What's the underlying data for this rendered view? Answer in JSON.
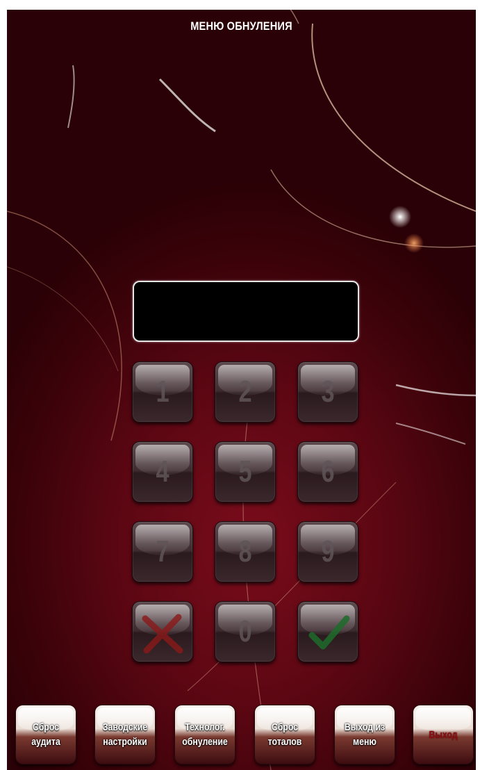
{
  "screen": {
    "title": "МЕНЮ ОБНУЛЕНИЯ",
    "display_value": ""
  },
  "keypad": {
    "keys": [
      {
        "label": "1"
      },
      {
        "label": "2"
      },
      {
        "label": "3"
      },
      {
        "label": "4"
      },
      {
        "label": "5"
      },
      {
        "label": "6"
      },
      {
        "label": "7"
      },
      {
        "label": "8"
      },
      {
        "label": "9"
      },
      {
        "label": "",
        "icon": "cancel-x-icon",
        "color": "#8b1a1a"
      },
      {
        "label": "0"
      },
      {
        "label": "",
        "icon": "confirm-check-icon",
        "color": "#1d6b2a"
      }
    ]
  },
  "bottom_bar": {
    "buttons": [
      {
        "label": "Сброс\nаудита"
      },
      {
        "label": "Заводские\nнастройки"
      },
      {
        "label": "Технолог.\nобнуление"
      },
      {
        "label": "Сброс\nтоталов"
      },
      {
        "label": "Выход из\nменю"
      },
      {
        "label": "Выход",
        "color": "#8a0d12"
      }
    ]
  },
  "colors": {
    "background": "#5c0713",
    "display_bg": "#000000"
  }
}
